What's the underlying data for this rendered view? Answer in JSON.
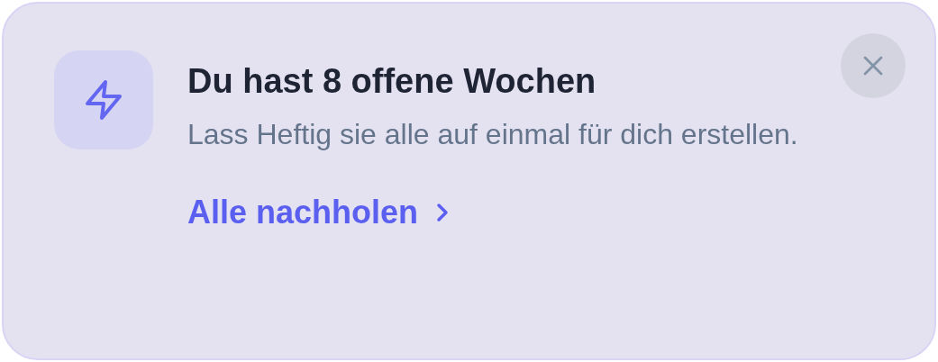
{
  "notice": {
    "title": "Du hast 8 offene Wochen",
    "message": "Lass Heftig sie alle auf einmal für dich erstellen.",
    "action": "Alle nachholen"
  }
}
